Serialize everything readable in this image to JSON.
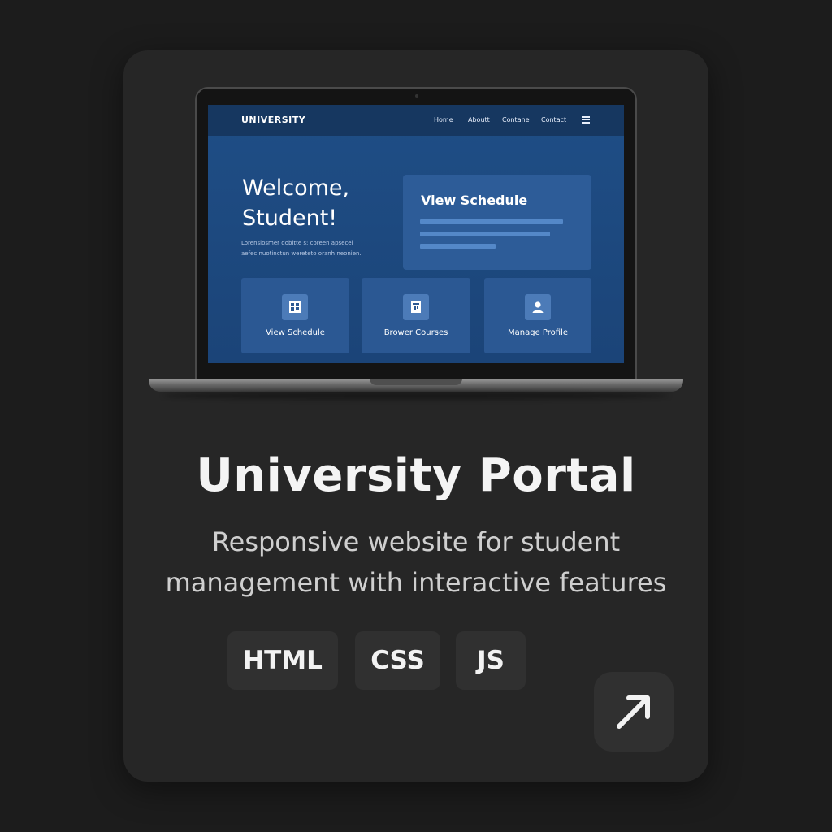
{
  "site": {
    "brand": "UNIVERSITY",
    "nav": [
      "Home",
      "Aboutt",
      "Contane",
      "Contact"
    ],
    "hero_title_line1": "Welcome,",
    "hero_title_line2": "Student!",
    "hero_text_line1": "Lorensiosmer dobitte s: coreen apsecel",
    "hero_text_line2": "aefec nuotinctun wereteto oranh neonien.",
    "schedule_card_title": "View Schedule",
    "tiles": [
      {
        "label": "View Schedule",
        "icon": "calendar-icon"
      },
      {
        "label": "Brower Courses",
        "icon": "book-icon"
      },
      {
        "label": "Manage Profile",
        "icon": "user-icon"
      }
    ],
    "colors": {
      "screen_bg": "#1f4e86",
      "nav_bg": "#163760",
      "card_bg": "#2d5c98"
    }
  },
  "project": {
    "title": "University Portal",
    "description_line1": "Responsive website for student",
    "description_line2": "management with interactive features",
    "tags": [
      "HTML",
      "CSS",
      "JS"
    ],
    "open_icon": "arrow-up-right-icon"
  },
  "colors": {
    "page_bg": "#1c1c1c",
    "card_bg": "#262626",
    "tag_bg": "#303030"
  }
}
